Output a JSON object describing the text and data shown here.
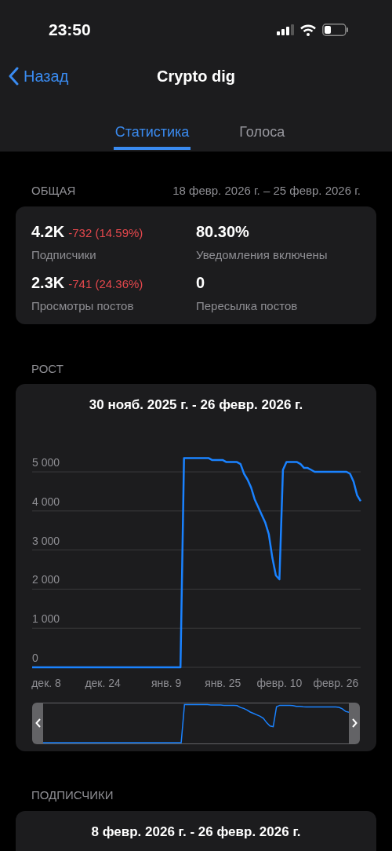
{
  "status_bar": {
    "time": "23:50"
  },
  "nav": {
    "back": "Назад",
    "title": "Crypto dig"
  },
  "tabs": [
    {
      "label": "Статистика",
      "selected": true
    },
    {
      "label": "Голоса",
      "selected": false
    }
  ],
  "overview": {
    "header": "ОБЩАЯ",
    "period": "18 февр. 2026 г. – 25 февр. 2026 г.",
    "stats": [
      {
        "value": "4.2K",
        "delta": "-732 (14.59%)",
        "label": "Подписчики"
      },
      {
        "value": "80.30%",
        "label": "Уведомления включены"
      },
      {
        "value": "2.3K",
        "delta": "-741 (24.36%)",
        "label": "Просмотры постов"
      },
      {
        "value": "0",
        "label": "Пересылка постов"
      }
    ]
  },
  "growth": {
    "header": "РОСТ",
    "chart_data": {
      "type": "line",
      "title": "30 нояб. 2025 г. - 26 февр. 2026 г.",
      "categories": [
        null,
        null,
        null,
        null,
        "дек. 8",
        null,
        null,
        null,
        null,
        null,
        null,
        null,
        null,
        null,
        null,
        null,
        null,
        null,
        null,
        null,
        "дек. 24",
        null,
        null,
        null,
        null,
        null,
        null,
        null,
        null,
        null,
        null,
        null,
        null,
        null,
        null,
        null,
        null,
        null,
        "янв. 9",
        null,
        null,
        null,
        null,
        null,
        null,
        null,
        null,
        null,
        null,
        null,
        null,
        null,
        null,
        null,
        "янв. 25",
        null,
        null,
        null,
        null,
        null,
        null,
        null,
        null,
        null,
        null,
        null,
        null,
        null,
        null,
        null,
        "февр. 10",
        null,
        null,
        null,
        null,
        null,
        null,
        null,
        null,
        null,
        null,
        null,
        null,
        null,
        null,
        null,
        "февр. 26",
        null,
        null,
        null,
        null,
        null,
        null,
        null
      ],
      "series": [
        {
          "color": "#1a82ff",
          "values": [
            0,
            0,
            0,
            0,
            0,
            0,
            0,
            0,
            0,
            0,
            0,
            0,
            0,
            0,
            0,
            0,
            0,
            0,
            0,
            0,
            0,
            0,
            0,
            0,
            0,
            0,
            0,
            0,
            0,
            0,
            0,
            0,
            0,
            0,
            0,
            0,
            0,
            0,
            0,
            0,
            0,
            0,
            0,
            5350,
            5350,
            5350,
            5350,
            5350,
            5350,
            5350,
            5350,
            5300,
            5300,
            5300,
            5300,
            5250,
            5250,
            5250,
            5250,
            5200,
            4950,
            4800,
            4600,
            4300,
            4100,
            3900,
            3700,
            3400,
            2800,
            2350,
            2250,
            5050,
            5250,
            5250,
            5250,
            5250,
            5200,
            5100,
            5100,
            5050,
            5000,
            5000,
            5000,
            5000,
            5000,
            5000,
            5000,
            5000,
            5000,
            5000,
            4950,
            4750,
            4400,
            4250
          ]
        }
      ],
      "ylim": [
        0,
        7240
      ],
      "grid": true,
      "yticks": [
        {
          "value": 0,
          "label": "0"
        },
        {
          "value": 1000,
          "label": "1 000"
        },
        {
          "value": 2000,
          "label": "2 000"
        },
        {
          "value": 3000,
          "label": "3 000"
        },
        {
          "value": 4000,
          "label": "4 000"
        },
        {
          "value": 5000,
          "label": "5 000"
        }
      ]
    }
  },
  "subscribers": {
    "header": "ПОДПИСЧИКИ",
    "title": "8 февр. 2026 г. - 26 февр. 2026 г."
  }
}
